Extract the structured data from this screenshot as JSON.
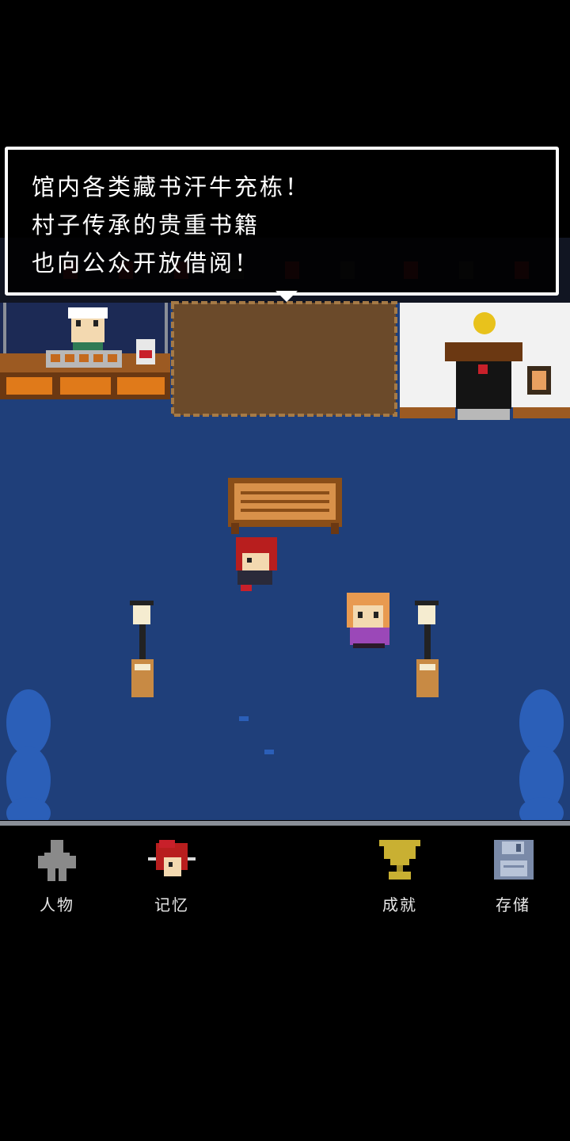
{
  "dialog": {
    "lines": [
      "馆内各类藏书汗牛充栋！",
      "村子传承的贵重书籍",
      "也向公众开放借阅！"
    ],
    "next_indicator": "triangle-down-icon"
  },
  "hud": {
    "buttons": [
      {
        "label": "人物",
        "icon": "person-silhouette-icon"
      },
      {
        "label": "记忆",
        "icon": "red-hair-portrait-icon"
      },
      {
        "label": "成就",
        "icon": "trophy-icon"
      },
      {
        "label": "存储",
        "icon": "floppy-disk-icon"
      }
    ]
  },
  "colors": {
    "ground": "#1f3f7a",
    "dirt": "#6b4a2a",
    "wood": "#c46a1e",
    "trophy": "#c9b032",
    "accent_red": "#c8202a"
  }
}
